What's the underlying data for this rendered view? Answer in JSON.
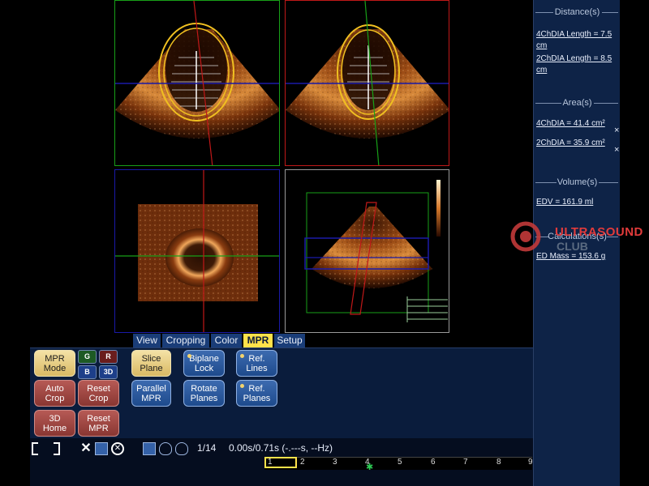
{
  "tabs": [
    {
      "label": "View",
      "active": false
    },
    {
      "label": "Cropping",
      "active": false
    },
    {
      "label": "Color",
      "active": false
    },
    {
      "label": "MPR",
      "active": true
    },
    {
      "label": "Setup",
      "active": false
    }
  ],
  "controls": {
    "mpr_mode": "MPR\nMode",
    "mini": {
      "g": "G",
      "r": "R",
      "b": "B",
      "three_d": "3D"
    },
    "auto_crop": "Auto\nCrop",
    "reset_crop": "Reset\nCrop",
    "home_3d": "3D\nHome",
    "reset_mpr": "Reset\nMPR",
    "slice_plane": "Slice\nPlane",
    "parallel_mpr": "Parallel\nMPR",
    "biplane_lock": "Biplane\nLock",
    "rotate_planes": "Rotate\nPlanes",
    "ref_lines": "Ref.\nLines",
    "ref_planes": "Ref.\nPlanes"
  },
  "measurements": {
    "distance_title": "Distance(s)",
    "distances": [
      "4ChDIA Length = 7.5 cm",
      "2ChDIA Length = 8.5 cm"
    ],
    "area_title": "Area(s)",
    "areas": [
      "4ChDIA = 41.4 cm²",
      "2ChDIA = 35.9 cm²"
    ],
    "volume_title": "Volume(s)",
    "volumes": [
      "EDV = 161.9 ml"
    ],
    "calc_title": "Calculations(s)",
    "calcs": [
      "ED Mass = 153.6 g"
    ],
    "close_glyph": "×"
  },
  "watermark": {
    "line1": "ULTRASOUND",
    "line2": "CLUB"
  },
  "cine": {
    "frame": "1/14",
    "time": "0.00s/0.71s (-.---s, --Hz)",
    "ticks": [
      "1",
      "2",
      "3",
      "4",
      "5",
      "6",
      "7",
      "8",
      "9"
    ]
  },
  "colors": {
    "panel_bg": "#0e2347",
    "active_tab": "#ffe24a",
    "quad_green": "#18a018",
    "quad_red": "#c01818",
    "quad_blue": "#1a1aa8"
  }
}
